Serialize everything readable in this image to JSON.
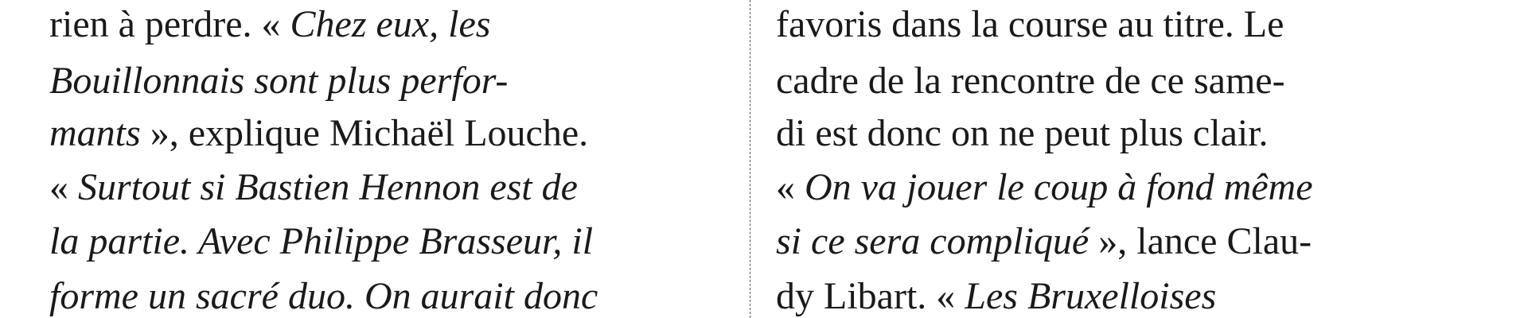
{
  "left_column": {
    "lines": [
      {
        "segments": [
          {
            "text": "rien à perdre. « ",
            "italic": false
          },
          {
            "text": "Chez eux, les",
            "italic": true
          }
        ]
      },
      {
        "segments": [
          {
            "text": "Bouillonnais sont plus perfor-",
            "italic": true
          }
        ]
      },
      {
        "segments": [
          {
            "text": "mants",
            "italic": true
          },
          {
            "text": " », explique Michaël Louche.",
            "italic": false
          }
        ]
      },
      {
        "segments": [
          {
            "text": "« ",
            "italic": false
          },
          {
            "text": "Surtout si Bastien Hennon est de",
            "italic": true
          }
        ]
      },
      {
        "segments": [
          {
            "text": "la partie. Avec Philippe Brasseur, il",
            "italic": true
          }
        ]
      },
      {
        "segments": [
          {
            "text": "forme un sacré duo. On aurait donc",
            "italic": true
          }
        ]
      }
    ]
  },
  "right_column": {
    "lines": [
      {
        "segments": [
          {
            "text": "favoris dans la course au titre. Le",
            "italic": false
          }
        ]
      },
      {
        "segments": [
          {
            "text": "cadre de la rencontre de ce same-",
            "italic": false
          }
        ]
      },
      {
        "segments": [
          {
            "text": "di est donc on ne peut plus clair.",
            "italic": false
          }
        ]
      },
      {
        "segments": [
          {
            "text": "« ",
            "italic": false
          },
          {
            "text": "On va jouer le coup à fond même",
            "italic": true
          }
        ]
      },
      {
        "segments": [
          {
            "text": "si ce sera compliqué",
            "italic": true
          },
          {
            "text": " », lance Clau-",
            "italic": false
          }
        ]
      },
      {
        "segments": [
          {
            "text": "dy Libart. « ",
            "italic": false
          },
          {
            "text": "Les Bruxelloises",
            "italic": true
          }
        ]
      }
    ]
  }
}
